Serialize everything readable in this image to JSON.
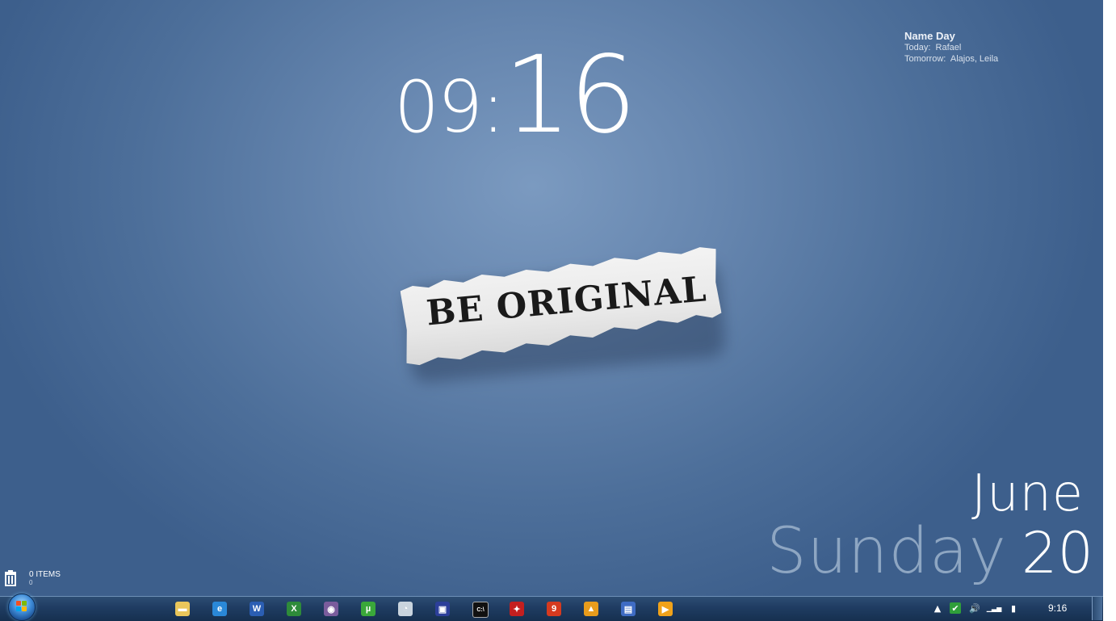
{
  "clock": {
    "hours": "09:",
    "minutes": "16"
  },
  "nameday": {
    "title": "Name Day",
    "today_label": "Today:",
    "today_names": "Rafael",
    "tomorrow_label": "Tomorrow:",
    "tomorrow_names": "Alajos, Leila"
  },
  "wallpaper": {
    "note_text": "BE ORIGINAL"
  },
  "date": {
    "month": "June",
    "weekday": "Sunday",
    "day": "20"
  },
  "recycle_bin": {
    "items": "0 ITEMS",
    "size": "0"
  },
  "taskbar": {
    "pinned": [
      {
        "name": "windows-explorer-icon",
        "glyph": "▬",
        "color": "#e9c65b"
      },
      {
        "name": "internet-explorer-icon",
        "glyph": "e",
        "color": "#2a88d8"
      },
      {
        "name": "word-icon",
        "glyph": "W",
        "color": "#2b5eb3"
      },
      {
        "name": "excel-icon",
        "glyph": "X",
        "color": "#2e8b3a"
      },
      {
        "name": "media-disc-icon",
        "glyph": "◉",
        "color": "#7a5c9c"
      },
      {
        "name": "utorrent-icon",
        "glyph": "µ",
        "color": "#3aa83a"
      },
      {
        "name": "speedometer-icon",
        "glyph": "◔",
        "color": "#c9d4de"
      },
      {
        "name": "floppy-save-icon",
        "glyph": "▣",
        "color": "#2c3f9a"
      },
      {
        "name": "command-prompt-icon",
        "glyph": "C:\\",
        "color": "#111111"
      },
      {
        "name": "acrobat-reader-icon",
        "glyph": "✦",
        "color": "#c41f1f"
      },
      {
        "name": "app-9-icon",
        "glyph": "9",
        "color": "#d63a1f"
      },
      {
        "name": "warning-app-icon",
        "glyph": "▲",
        "color": "#e89c1c"
      },
      {
        "name": "remote-desktop-icon",
        "glyph": "▤",
        "color": "#3f6cc4"
      },
      {
        "name": "media-player-icon",
        "glyph": "▶",
        "color": "#f0a21a"
      }
    ],
    "tray": {
      "show-hidden": "▲",
      "security": "✔",
      "volume": "🔊",
      "network": "▁▃▅",
      "power": "▮",
      "time": "9:16"
    }
  }
}
